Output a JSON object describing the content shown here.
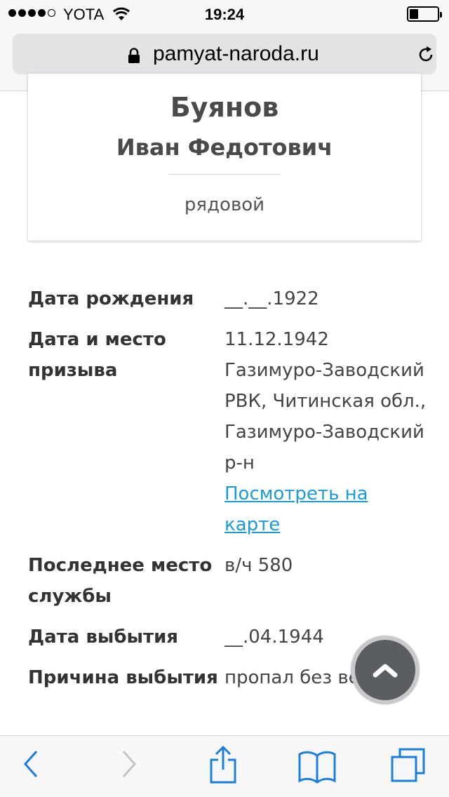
{
  "status_bar": {
    "carrier": "YOTA",
    "time": "19:24",
    "signal_bars_filled": 4,
    "signal_bars_total": 5
  },
  "browser": {
    "url": "pamyat-naroda.ru"
  },
  "person": {
    "surname": "Буянов",
    "given_name": "Иван Федотович",
    "rank": "рядовой"
  },
  "details": [
    {
      "label": "Дата рождения",
      "value": "__.__.1922"
    },
    {
      "label": "Дата и место призыва",
      "value": "11.12.1942 Газимуро-Заводский РВК, Читинская обл., Газимуро-Заводский р-н",
      "link": "Посмотреть на карте"
    },
    {
      "label": "Последнее место службы",
      "value": "в/ч 580"
    },
    {
      "label": "Дата выбытия",
      "value": "__.04.1944"
    },
    {
      "label": "Причина выбытия",
      "value": "пропал без вести"
    }
  ],
  "colors": {
    "link": "#1a9bd7",
    "toolbar_icon": "#1a7ee0",
    "toolbar_icon_disabled": "#c4c4c8"
  },
  "icons": {
    "lock": "lock-icon",
    "reload": "reload-icon",
    "back": "back-icon",
    "forward": "forward-icon",
    "share": "share-icon",
    "bookmarks": "bookmarks-icon",
    "tabs": "tabs-icon",
    "scroll_top": "chevron-up-icon"
  }
}
